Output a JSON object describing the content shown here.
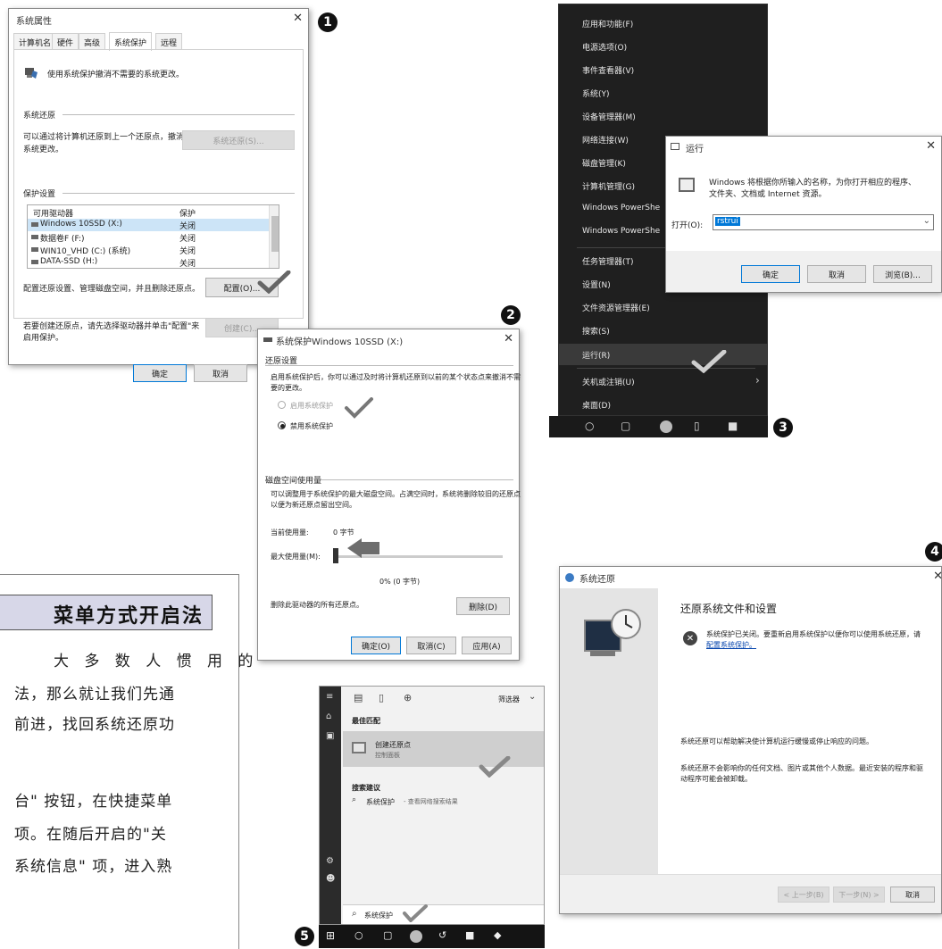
{
  "markers": [
    "1",
    "2",
    "3",
    "4",
    "5"
  ],
  "sysprops": {
    "title": "系统属性",
    "tabs": [
      "计算机名",
      "硬件",
      "高级",
      "系统保护",
      "远程"
    ],
    "header_text": "使用系统保护撤消不需要的系统更改。",
    "restore_section": "系统还原",
    "restore_desc_1": "可以通过将计算机还原到上一个还原点，撤消",
    "restore_desc_2": "系统更改。",
    "restore_button": "系统还原(S)...",
    "protection_section": "保护设置",
    "col_drives": "可用驱动器",
    "col_protection": "保护",
    "drives": [
      {
        "name": "Windows 10SSD (X:)",
        "status": "关闭"
      },
      {
        "name": "数据卷F (F:)",
        "status": "关闭"
      },
      {
        "name": "WIN10_VHD (C:) (系统)",
        "status": "关闭"
      },
      {
        "name": "DATA-SSD (H:)",
        "status": "关闭"
      }
    ],
    "config_desc": "配置还原设置、管理磁盘空间，并且删除还原点。",
    "config_button": "配置(O)...",
    "create_desc_1": "若要创建还原点，请先选择驱动器并单击\"配置\"来",
    "create_desc_2": "启用保护。",
    "create_button": "创建(C)...",
    "ok_button": "确定",
    "cancel_button": "取消"
  },
  "protdialog": {
    "title": "系统保护Windows 10SSD (X:)",
    "restore_section": "还原设置",
    "desc_1": "启用系统保护后，你可以通过及时将计算机还原到以前的某个状态点来撤消不需",
    "desc_2": "要的更改。",
    "radio_on": "启用系统保护",
    "radio_off": "禁用系统保护",
    "disk_section": "磁盘空间使用量",
    "disk_desc_1": "可以调整用于系统保护的最大磁盘空间。占满空间时，系统将删除较旧的还原点",
    "disk_desc_2": "以便为新还原点留出空间。",
    "current_label": "当前使用量:",
    "current_value": "0 字节",
    "max_label": "最大使用量(M):",
    "slider_value": "0% (0 字节)",
    "slider_fraction": 0,
    "delete_desc": "删除此驱动器的所有还原点。",
    "delete_button": "删除(D)",
    "ok_button": "确定(O)",
    "cancel_button": "取消(C)",
    "apply_button": "应用(A)"
  },
  "winx": {
    "items": [
      "应用和功能(F)",
      "电源选项(O)",
      "事件查看器(V)",
      "系统(Y)",
      "设备管理器(M)",
      "网络连接(W)",
      "磁盘管理(K)",
      "计算机管理(G)",
      "Windows PowerShe",
      "Windows PowerShe",
      "任务管理器(T)",
      "设置(N)",
      "文件资源管理器(E)",
      "搜索(S)",
      "运行(R)",
      "关机或注销(U)",
      "桌面(D)"
    ]
  },
  "rundialog": {
    "title": "运行",
    "desc_1": "Windows 将根据你所输入的名称，为你打开相应的程序、",
    "desc_2": "文件夹、文档或 Internet 资源。",
    "open_label": "打开(O):",
    "input_value": "rstrui",
    "ok_button": "确定",
    "cancel_button": "取消",
    "browse_button": "浏览(B)..."
  },
  "restorewiz": {
    "title": "系统还原",
    "heading": "还原系统文件和设置",
    "error_text": "系统保护已关闭。要重新启用系统保护以便你可以使用系统还原，请",
    "error_link": "配置系统保护。",
    "info_1": "系统还原可以帮助解决使计算机运行缓慢或停止响应的问题。",
    "info_2a": "系统还原不会影响你的任何文档、图片或其他个人数据。最近安装的程序和驱",
    "info_2b": "动程序可能会被卸载。",
    "back_button": "< 上一步(B)",
    "next_button": "下一步(N) >",
    "cancel_button": "取消"
  },
  "searchpanel": {
    "filter_label": "筛选器",
    "best_match": "最佳匹配",
    "result_title": "创建还原点",
    "result_sub": "控制面板",
    "suggest_header": "搜索建议",
    "suggest_item": "系统保护",
    "suggest_suffix": " - 查看网络搜索结果",
    "search_text": "系统保护"
  },
  "article": {
    "heading": "菜单方式开启法",
    "lines": [
      "大 多 数 人 惯 用 的",
      "法，那么就让我们先通",
      "前进，找回系统还原功",
      "台\" 按钮，在快捷菜单",
      "项。在随后开启的\"关",
      "系统信息\" 项，进入熟"
    ]
  }
}
